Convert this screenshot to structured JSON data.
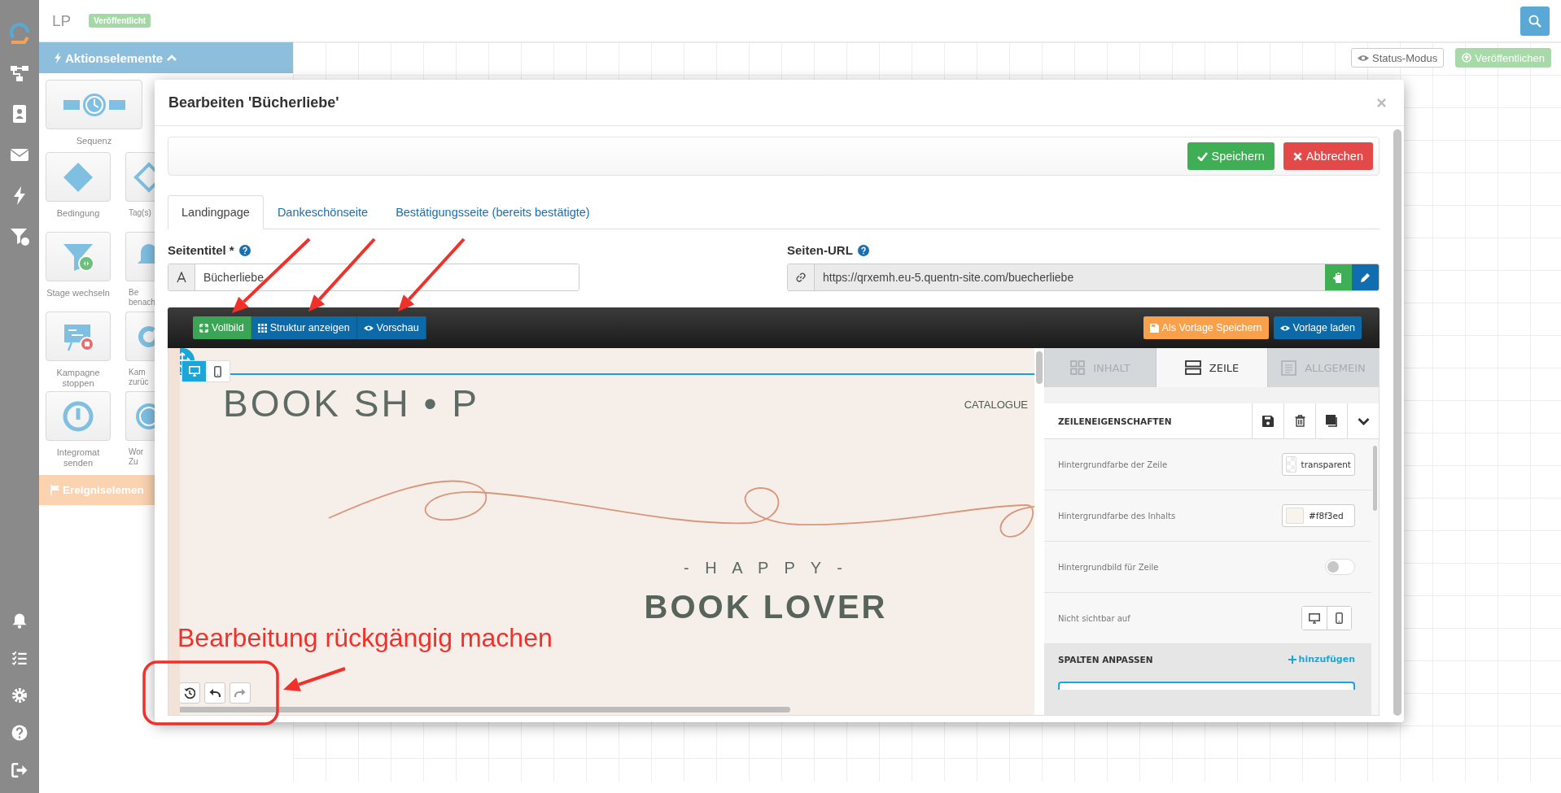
{
  "app": {
    "title": "LP",
    "status_badge": "Veröffentlicht"
  },
  "palette": {
    "title": "Aktionselemente",
    "items": [
      {
        "kind": "wide",
        "lines": [
          "Sequenz"
        ]
      },
      {
        "kind": "tile",
        "lines": [
          "Bedingung"
        ]
      },
      {
        "kind": "cut",
        "lines": [
          "Tag(s)"
        ]
      },
      {
        "kind": "tile",
        "lines": [
          "Stage wechseln"
        ]
      },
      {
        "kind": "cut",
        "lines": [
          "Be",
          "benach"
        ]
      },
      {
        "kind": "tile",
        "lines": [
          "Kampagne",
          "stoppen"
        ]
      },
      {
        "kind": "cut",
        "lines": [
          "Kam",
          "zurüc"
        ]
      },
      {
        "kind": "tile",
        "lines": [
          "Integromat",
          "senden"
        ]
      },
      {
        "kind": "cut",
        "lines": [
          "Wor",
          "Zu"
        ]
      }
    ],
    "events_title": "Ereigniselemen"
  },
  "canvas_toolbar": {
    "buttons": [
      {
        "label": "Status-Modus",
        "disabled": false
      },
      {
        "label": "Veröffentlichen",
        "disabled": true
      }
    ]
  },
  "dialog": {
    "title": "Bearbeiten 'Bücherliebe'",
    "actions": [
      {
        "label": "Speichern",
        "kind": "save"
      },
      {
        "label": "Abbrechen",
        "kind": "cancel"
      }
    ],
    "tabs": [
      {
        "label": "Landingpage",
        "selected": true
      },
      {
        "label": "Dankeschönseite",
        "selected": false
      },
      {
        "label": "Bestätigungsseite (bereits bestätigte)",
        "selected": false
      }
    ],
    "fields": [
      {
        "kind": "title",
        "label": "Seitentitel *",
        "value": "Bücherliebe"
      },
      {
        "kind": "url",
        "label": "Seiten-URL",
        "value": "https://qrxemh.eu-5.quentn-site.com/buecherliebe"
      }
    ],
    "editor": {
      "left_buttons": [
        {
          "label": "Vollbild",
          "kind": "fullscreen"
        },
        {
          "label": "Struktur anzeigen",
          "kind": "structure"
        },
        {
          "label": "Vorschau",
          "kind": "preview"
        }
      ],
      "right_buttons": [
        {
          "label": "Als Vorlage Speichern",
          "kind": "save_template"
        },
        {
          "label": "Vorlage laden",
          "kind": "load_template"
        }
      ],
      "preview": {
        "logo": "BOOK SH • P",
        "nav": "CATALOGUE",
        "kicker": "- H A P P Y -",
        "headline": "BOOK LOVER",
        "devices": [
          {
            "selected": true
          },
          {
            "selected": false
          }
        ]
      },
      "panel": {
        "tabs": [
          {
            "label": "INHALT",
            "selected": false
          },
          {
            "label": "ZEILE",
            "selected": true
          },
          {
            "label": "ALLGEMEIN",
            "selected": false
          }
        ],
        "section_title": "ZEILENEIGENSCHAFTEN",
        "rows": [
          {
            "kind": "color",
            "label": "Hintergrundfarbe der Zeile",
            "value": "transparent"
          },
          {
            "kind": "color",
            "label": "Hintergrundfarbe des Inhalts",
            "value": "#f8f3ed",
            "color": "#f8f3ed"
          },
          {
            "kind": "toggle",
            "label": "Hintergrundbild für Zeile",
            "on": false
          },
          {
            "kind": "devices",
            "label": "Nicht sichtbar auf"
          }
        ],
        "columns_title": "SPALTEN ANPASSEN",
        "add_label": "hinzufügen"
      }
    }
  },
  "annotation": {
    "text": "Bearbeitung rückgängig machen"
  }
}
